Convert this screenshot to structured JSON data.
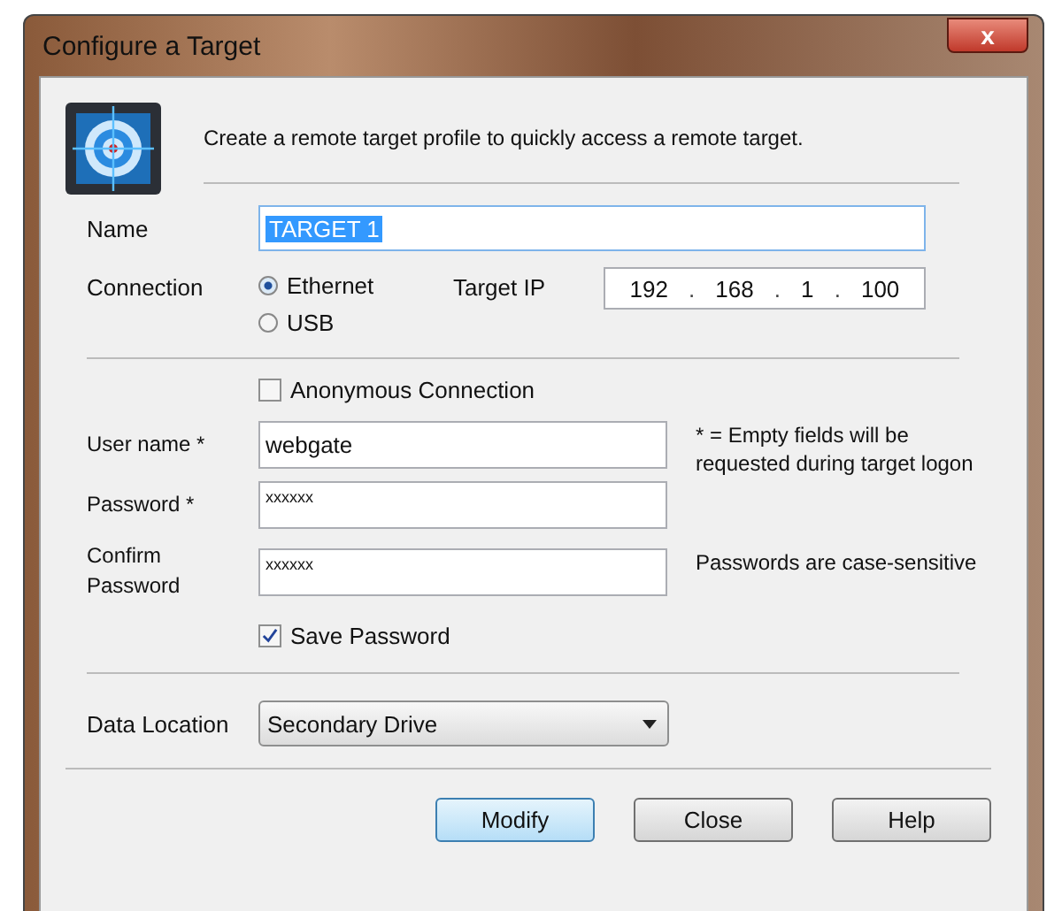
{
  "window": {
    "title": "Configure a Target",
    "close_symbol": "x"
  },
  "description": "Create a remote target profile to quickly access a remote target.",
  "name": {
    "label": "Name",
    "value": "TARGET 1"
  },
  "connection": {
    "label": "Connection",
    "options": [
      {
        "label": "Ethernet",
        "selected": true
      },
      {
        "label": "USB",
        "selected": false
      }
    ],
    "ip_label": "Target IP",
    "ip_parts": [
      "192",
      "168",
      "1",
      "100"
    ],
    "ip_separator": "."
  },
  "anonymous": {
    "label": "Anonymous Connection",
    "checked": false
  },
  "fields": [
    {
      "label": "User name *",
      "value": "webgate"
    },
    {
      "label": "Password *",
      "value": "xxxxxx"
    },
    {
      "label": "Confirm Password",
      "value": "xxxxxx"
    }
  ],
  "notes": [
    "* = Empty fields will be requested during target logon",
    "Passwords are case-sensitive"
  ],
  "save_password": {
    "label": "Save Password",
    "checked": true
  },
  "data_location": {
    "label": "Data Location",
    "value": "Secondary Drive"
  },
  "buttons": [
    {
      "label": "Modify",
      "default": true
    },
    {
      "label": "Close",
      "default": false
    },
    {
      "label": "Help",
      "default": false
    }
  ]
}
